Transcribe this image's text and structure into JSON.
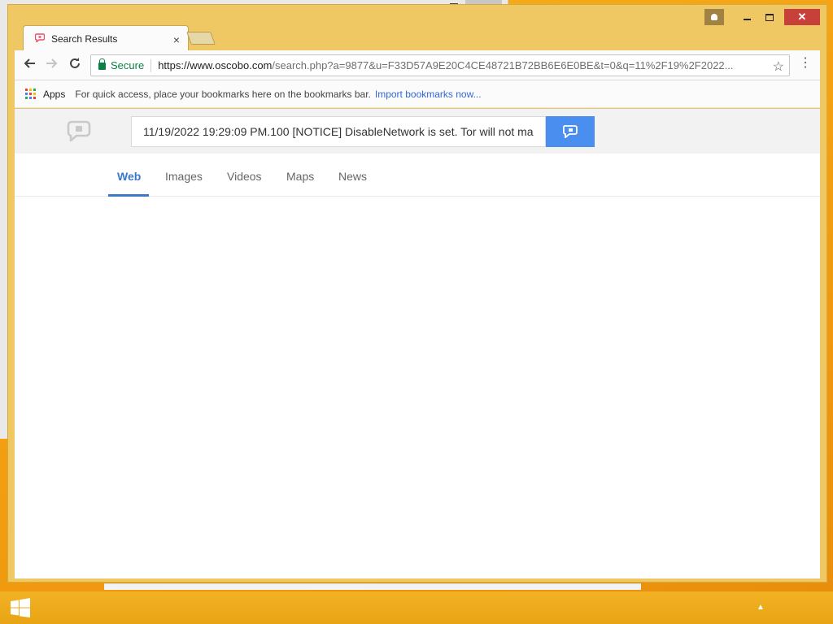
{
  "window": {
    "tab_title": "Search Results",
    "close_glyph": "×"
  },
  "toolbar": {
    "secure_label": "Secure",
    "url_host": "https://www.oscobo.com",
    "url_rest": "/search.php?a=9877&u=F33D57A9E20C4CE48721B72BB6E6E0BE&t=0&q=11%2F19%2F2022..."
  },
  "bookmarks": {
    "apps_label": "Apps",
    "hint_text": "For quick access, place your bookmarks here on the bookmarks bar.",
    "import_link": "Import bookmarks now..."
  },
  "search": {
    "query": "11/19/2022 19:29:09 PM.100 [NOTICE] DisableNetwork is set. Tor will not ma"
  },
  "nav_tabs": [
    {
      "label": "Web"
    },
    {
      "label": "Images"
    },
    {
      "label": "Videos"
    },
    {
      "label": "Maps"
    },
    {
      "label": "News"
    }
  ],
  "colors": {
    "accent": "#3a78c9",
    "search_button": "#4a8ef0",
    "frame": "#f0c863",
    "close": "#c7403a"
  }
}
